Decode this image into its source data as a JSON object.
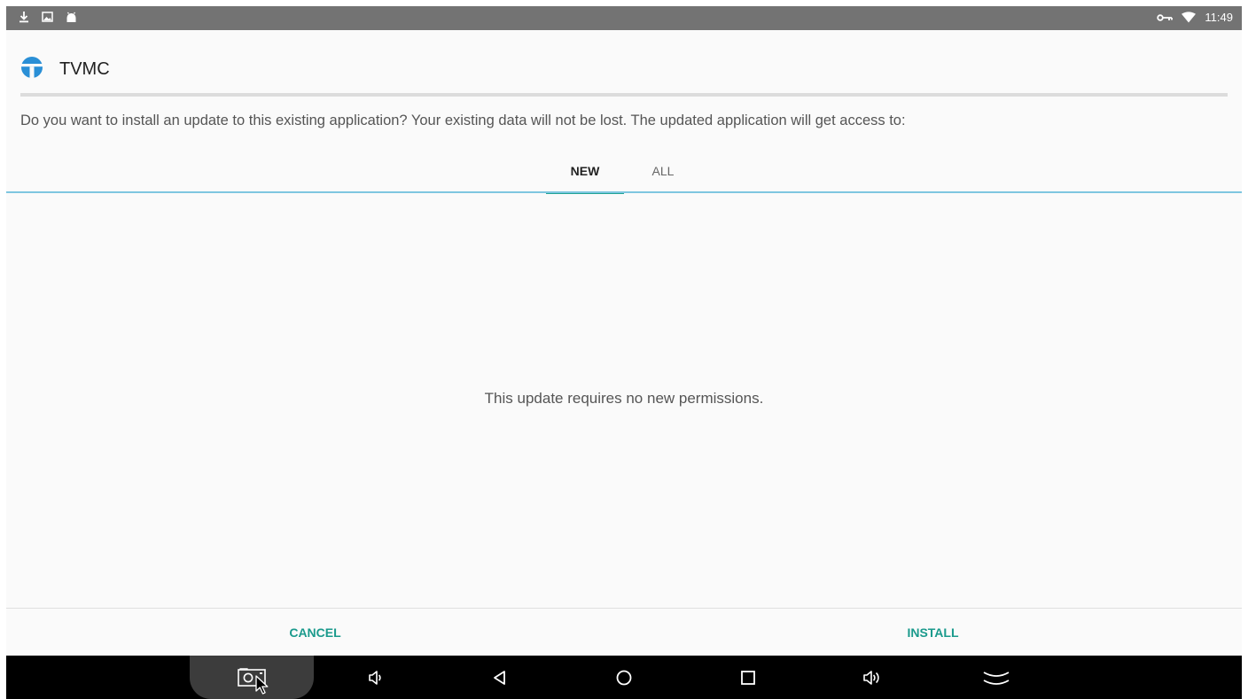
{
  "status_bar": {
    "left_icons": [
      "download-icon",
      "image-icon",
      "android-icon"
    ],
    "right_icons": [
      "vpn-key-icon",
      "wifi-icon"
    ],
    "time": "11:49"
  },
  "dialog": {
    "app_icon": "tvmc-logo-icon",
    "app_name": "TVMC",
    "message": "Do you want to install an update to this existing application? Your existing data will not be lost. The updated application will get access to:",
    "tabs": [
      {
        "label": "NEW",
        "selected": true
      },
      {
        "label": "ALL",
        "selected": false
      }
    ],
    "permissions_text": "This update requires no new permissions.",
    "cancel_label": "CANCEL",
    "install_label": "INSTALL"
  },
  "nav_bar": {
    "buttons": [
      "screenshot-icon",
      "volume-down-icon",
      "back-icon",
      "home-icon",
      "recents-icon",
      "volume-up-icon",
      "hide-bar-icon"
    ]
  },
  "colors": {
    "status_bar": "#737373",
    "accent": "#1a9a8c",
    "tab_underline": "#7ec6e0",
    "logo_blue": "#2a8fd6",
    "nav_bar": "#000000"
  }
}
